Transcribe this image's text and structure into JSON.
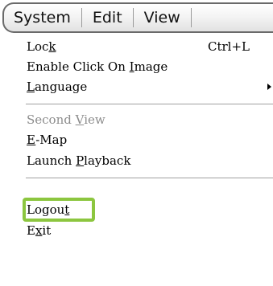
{
  "menubar": {
    "items": [
      {
        "label": "System"
      },
      {
        "label": "Edit"
      },
      {
        "label": "View"
      }
    ]
  },
  "dropdown": {
    "lock": {
      "pre": "Loc",
      "mn": "k",
      "post": "",
      "shortcut": "Ctrl+L"
    },
    "enable_click": {
      "pre": "Enable Click On ",
      "mn": "I",
      "post": "mage"
    },
    "language": {
      "pre": "",
      "mn": "L",
      "post": "anguage"
    },
    "second_view": {
      "pre": "Second ",
      "mn": "V",
      "post": "iew",
      "disabled": true
    },
    "emap": {
      "pre": "",
      "mn": "E",
      "post": "-Map"
    },
    "launch_playback": {
      "pre": "Launch ",
      "mn": "P",
      "post": "layback"
    },
    "logout": {
      "pre": "Logou",
      "mn": "t",
      "post": "",
      "highlighted": true
    },
    "exit": {
      "pre": "E",
      "mn": "x",
      "post": "it"
    }
  },
  "colors": {
    "highlight": "#8cc63f",
    "disabled_text": "#8c8c8c"
  },
  "icons": {
    "submenu": "submenu-arrow-icon"
  }
}
